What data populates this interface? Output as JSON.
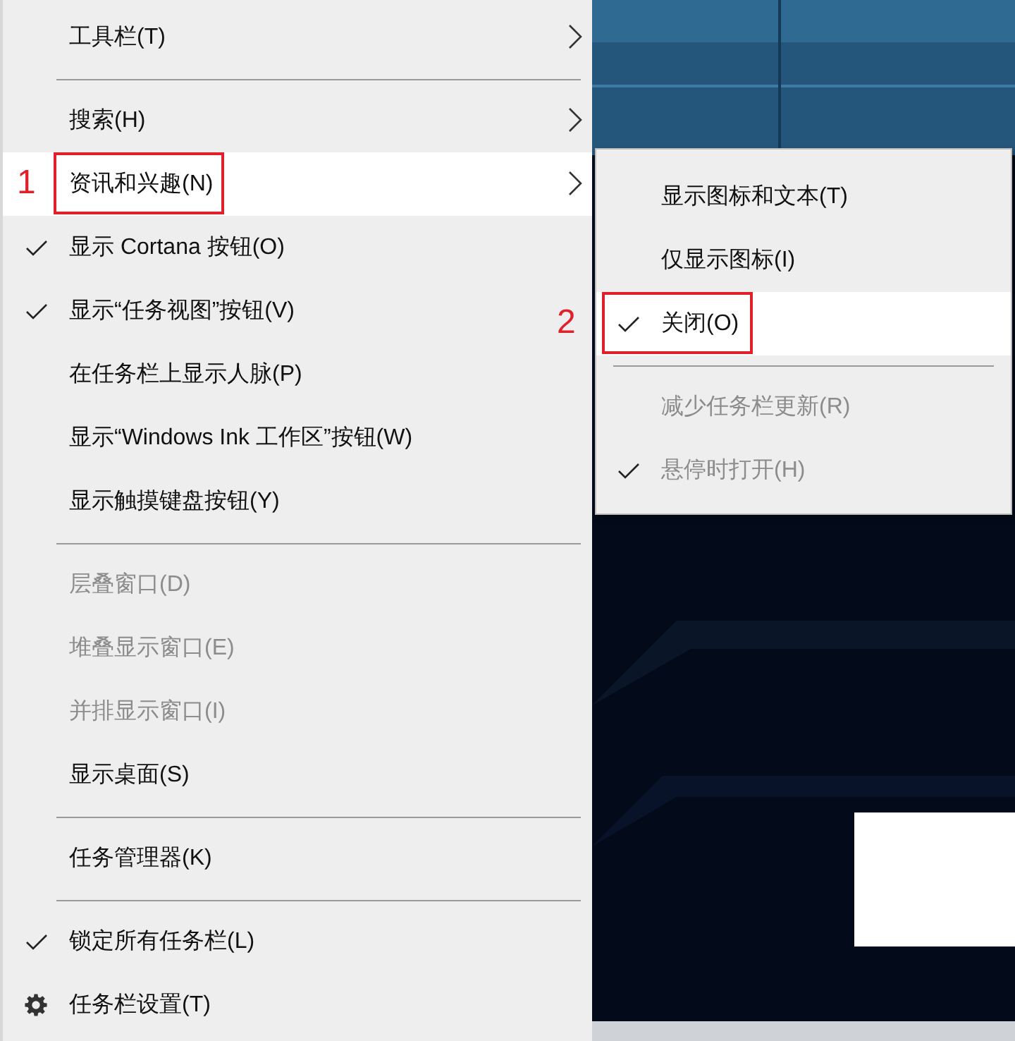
{
  "menu": {
    "items": [
      {
        "kind": "item",
        "label": "工具栏(T)",
        "checked": false,
        "disabled": false,
        "has_submenu": true,
        "selected": false
      },
      {
        "kind": "separator"
      },
      {
        "kind": "item",
        "label": "搜索(H)",
        "checked": false,
        "disabled": false,
        "has_submenu": true,
        "selected": false
      },
      {
        "kind": "item",
        "label": "资讯和兴趣(N)",
        "checked": false,
        "disabled": false,
        "has_submenu": true,
        "selected": true,
        "callout": "1"
      },
      {
        "kind": "item",
        "label": "显示 Cortana 按钮(O)",
        "checked": true,
        "disabled": false,
        "has_submenu": false,
        "selected": false
      },
      {
        "kind": "item",
        "label": "显示“任务视图”按钮(V)",
        "checked": true,
        "disabled": false,
        "has_submenu": false,
        "selected": false
      },
      {
        "kind": "item",
        "label": "在任务栏上显示人脉(P)",
        "checked": false,
        "disabled": false,
        "has_submenu": false,
        "selected": false
      },
      {
        "kind": "item",
        "label": "显示“Windows Ink 工作区”按钮(W)",
        "checked": false,
        "disabled": false,
        "has_submenu": false,
        "selected": false
      },
      {
        "kind": "item",
        "label": "显示触摸键盘按钮(Y)",
        "checked": false,
        "disabled": false,
        "has_submenu": false,
        "selected": false
      },
      {
        "kind": "separator"
      },
      {
        "kind": "item",
        "label": "层叠窗口(D)",
        "checked": false,
        "disabled": true,
        "has_submenu": false,
        "selected": false
      },
      {
        "kind": "item",
        "label": "堆叠显示窗口(E)",
        "checked": false,
        "disabled": true,
        "has_submenu": false,
        "selected": false
      },
      {
        "kind": "item",
        "label": "并排显示窗口(I)",
        "checked": false,
        "disabled": true,
        "has_submenu": false,
        "selected": false
      },
      {
        "kind": "item",
        "label": "显示桌面(S)",
        "checked": false,
        "disabled": false,
        "has_submenu": false,
        "selected": false
      },
      {
        "kind": "separator"
      },
      {
        "kind": "item",
        "label": "任务管理器(K)",
        "checked": false,
        "disabled": false,
        "has_submenu": false,
        "selected": false
      },
      {
        "kind": "separator"
      },
      {
        "kind": "item",
        "label": "锁定所有任务栏(L)",
        "checked": true,
        "disabled": false,
        "has_submenu": false,
        "selected": false
      },
      {
        "kind": "icon-item",
        "label": "任务栏设置(T)",
        "checked": false,
        "disabled": false,
        "has_submenu": false,
        "selected": false
      }
    ]
  },
  "submenu": {
    "items": [
      {
        "kind": "item",
        "label": "显示图标和文本(T)",
        "checked": false,
        "disabled": false,
        "selected": false
      },
      {
        "kind": "item",
        "label": "仅显示图标(I)",
        "checked": false,
        "disabled": false,
        "selected": false
      },
      {
        "kind": "item",
        "label": "关闭(O)",
        "checked": true,
        "disabled": false,
        "selected": true,
        "callout": "2"
      },
      {
        "kind": "separator"
      },
      {
        "kind": "item",
        "label": "减少任务栏更新(R)",
        "checked": false,
        "disabled": true,
        "selected": false
      },
      {
        "kind": "item",
        "label": "悬停时打开(H)",
        "checked": true,
        "disabled": true,
        "selected": false
      }
    ]
  }
}
